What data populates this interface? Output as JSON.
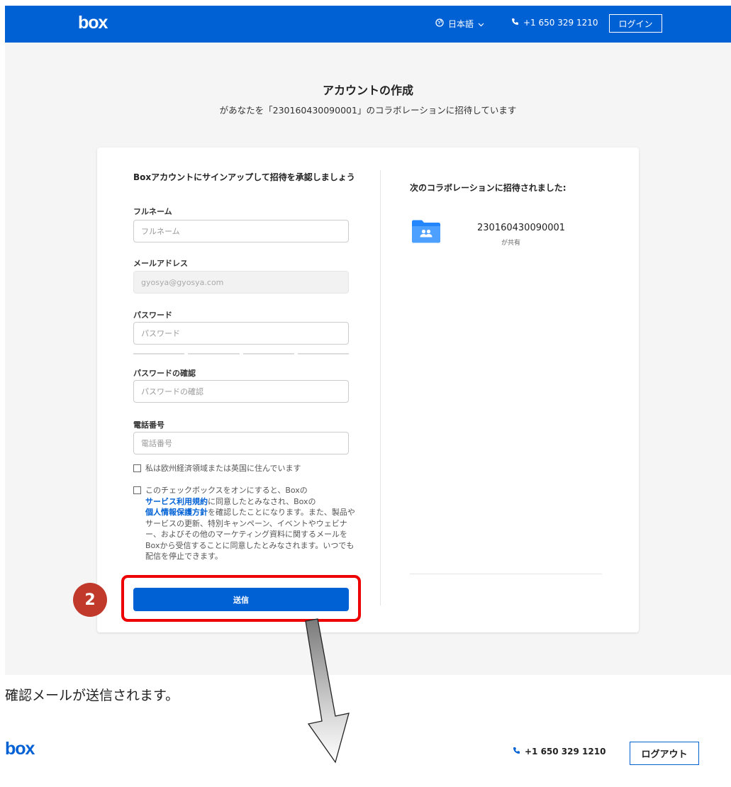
{
  "header": {
    "logo": "box",
    "language": "日本語",
    "phone": "+1 650 329 1210",
    "login_label": "ログイン"
  },
  "page": {
    "title": "アカウントの作成",
    "subtitle": "があなたを「230160430090001」のコラボレーションに招待しています"
  },
  "form": {
    "heading": "Boxアカウントにサインアップして招待を承認しましょう",
    "fullname_label": "フルネーム",
    "fullname_placeholder": "フルネーム",
    "email_label": "メールアドレス",
    "email_value": "gyosya@gyosya.com",
    "password_label": "パスワード",
    "password_placeholder": "パスワード",
    "confirm_label": "パスワードの確認",
    "confirm_placeholder": "パスワードの確認",
    "phone_label": "電話番号",
    "phone_placeholder": "電話番号",
    "eea_checkbox": "私は欧州経済領域または英国に住んでいます",
    "terms_part1": "このチェックボックスをオンにすると、Boxの",
    "terms_link1": "サービス利用規約",
    "terms_part2": "に同意したとみなされ、Boxの",
    "terms_link2": "個人情報保護方針",
    "terms_part3": "を確認したことになります。また、製品やサービスの更新、特別キャンペーン、イベントやウェビナー、およびその他のマーケティング資料に関するメールをBoxから受信することに同意したとみなされます。いつでも配信を停止できます。",
    "submit_label": "送信"
  },
  "annotation": {
    "step_number": "2",
    "caption": "確認メールが送信されます。",
    "highlight_color": "#ee0000",
    "badge_color": "#c0392b"
  },
  "collaboration": {
    "heading": "次のコラボレーションに招待されました:",
    "folder_icon": "shared-folder-icon",
    "name": "230160430090001",
    "shared_by": "が共有"
  },
  "second_header": {
    "logo": "box",
    "phone": "+1 650 329 1210",
    "logout_label": "ログアウト"
  },
  "colors": {
    "brand": "#0061d5",
    "background": "#f5f5f5"
  }
}
